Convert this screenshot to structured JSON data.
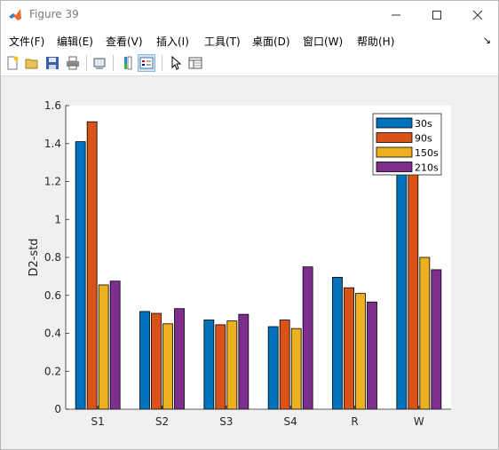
{
  "window": {
    "title": "Figure 39"
  },
  "menu": [
    "文件(F)",
    "编辑(E)",
    "查看(V)",
    "插入(I)",
    "工具(T)",
    "桌面(D)",
    "窗口(W)",
    "帮助(H)"
  ],
  "menu_overflow": "↘",
  "toolbar": {
    "icons": [
      "new-figure-icon",
      "open-file-icon",
      "save-icon",
      "print-icon",
      "link-plot-icon",
      "colorbar-icon",
      "legend-icon",
      "pointer-icon",
      "property-inspector-icon"
    ]
  },
  "colors": {
    "30s": "#0072BD",
    "90s": "#D95319",
    "150s": "#EDB120",
    "210s": "#7E2F8E"
  },
  "chart_data": {
    "type": "bar",
    "categories": [
      "S1",
      "S2",
      "S3",
      "S4",
      "R",
      "W"
    ],
    "ylabel": "D2-std",
    "xlabel": "",
    "ylim": [
      0,
      1.6
    ],
    "yticks": [
      "0",
      "0.2",
      "0.4",
      "0.6",
      "0.8",
      "1",
      "1.2",
      "1.4",
      "1.6"
    ],
    "legend_position": "top-right",
    "series": [
      {
        "name": "30s",
        "values": [
          1.41,
          0.515,
          0.47,
          0.435,
          0.695,
          1.32
        ]
      },
      {
        "name": "90s",
        "values": [
          1.515,
          0.505,
          0.445,
          0.47,
          0.64,
          1.3
        ]
      },
      {
        "name": "150s",
        "values": [
          0.655,
          0.45,
          0.465,
          0.425,
          0.61,
          0.8
        ]
      },
      {
        "name": "210s",
        "values": [
          0.675,
          0.53,
          0.5,
          0.75,
          0.565,
          0.735
        ]
      }
    ]
  }
}
